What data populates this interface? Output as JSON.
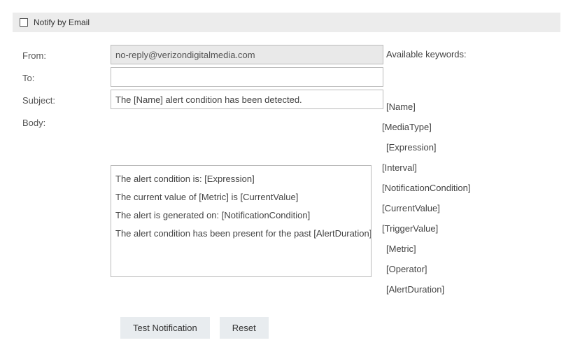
{
  "header": {
    "checkbox_label": "Notify by Email",
    "checked": false
  },
  "labels": {
    "from": "From:",
    "to": "To:",
    "subject": "Subject:",
    "body": "Body:"
  },
  "fields": {
    "from_value": "no-reply@verizondigitalmedia.com",
    "to_value": "",
    "subject_value": "The [Name] alert condition has been detected.",
    "body_lines": [
      "The alert condition is: [Expression]",
      "The current value of [Metric] is [CurrentValue]",
      "The alert is generated on: [NotificationCondition]",
      "The alert condition has been present for the past [AlertDuration] minutes"
    ]
  },
  "keywords": {
    "heading": "Available keywords:",
    "items": [
      "[Name]",
      "[MediaType]",
      "[Expression]",
      "[Interval]",
      "[NotificationCondition]",
      "[CurrentValue]",
      "[TriggerValue]",
      "[Metric]",
      "[Operator]",
      "[AlertDuration]"
    ]
  },
  "buttons": {
    "test": "Test Notification",
    "reset": "Reset"
  }
}
